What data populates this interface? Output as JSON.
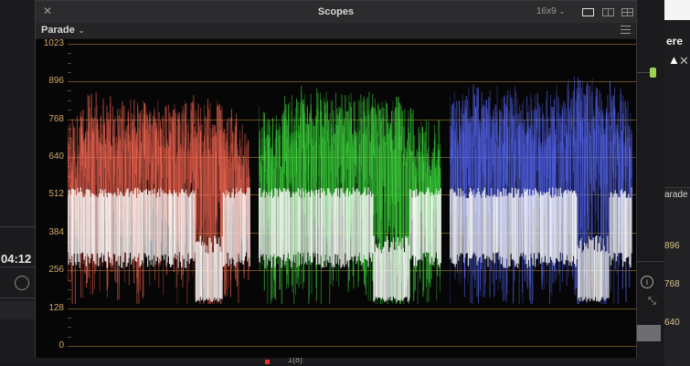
{
  "window": {
    "title": "Scopes",
    "close_icon": "close-icon",
    "aspect_label": "16x9",
    "layout_icons": [
      "single-view-icon",
      "split-view-icon",
      "quad-view-icon"
    ]
  },
  "toolbar": {
    "mode_label": "Parade",
    "settings_icon": "settings-icon"
  },
  "scope": {
    "type": "rgb-parade",
    "y_ticks": [
      "1023",
      "896",
      "768",
      "640",
      "512",
      "384",
      "256",
      "128",
      "0"
    ],
    "y_range": [
      0,
      1023
    ],
    "channels": [
      {
        "name": "red",
        "color": "#ff6a55"
      },
      {
        "name": "green",
        "color": "#3fe33f"
      },
      {
        "name": "blue",
        "color": "#5a6bff"
      }
    ],
    "grid_color": "#7a5c24"
  },
  "background": {
    "timecode_partial": "04:12",
    "right_panel_text": "ere",
    "right_panel_mode": "arade",
    "right_ticks": [
      "896",
      "768",
      "640"
    ],
    "bottom_text": "1(8)"
  }
}
